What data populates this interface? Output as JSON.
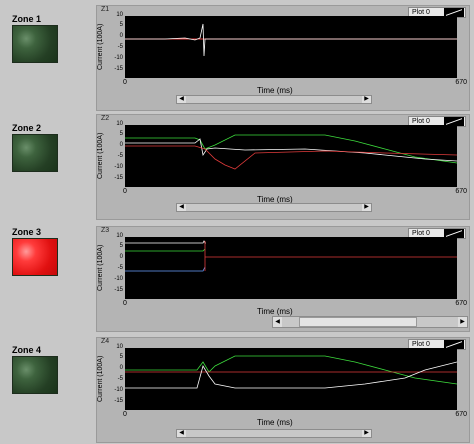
{
  "zones": [
    {
      "label": "Zone 1",
      "state": "off",
      "graph": "Z1"
    },
    {
      "label": "Zone 2",
      "state": "off",
      "graph": "Z2"
    },
    {
      "label": "Zone 3",
      "state": "on",
      "graph": "Z3"
    },
    {
      "label": "Zone 4",
      "state": "off",
      "graph": "Z4"
    }
  ],
  "graph_common": {
    "legend_label": "Plot 0",
    "ylabel": "Current (100A)",
    "yticks": [
      "10",
      "5",
      "0",
      "-5",
      "-10",
      "-15"
    ],
    "x_min": "0",
    "x_max": "670",
    "xlabel": "Time (ms)"
  },
  "colors": {
    "plot_bg": "#000000",
    "trace_white": "#ffffff",
    "trace_red": "#e03b3b",
    "trace_green": "#3ddc3d",
    "trace_blue": "#6aa0ff",
    "led_off": "#2e4e2e",
    "led_on": "#ff2a2a"
  }
}
